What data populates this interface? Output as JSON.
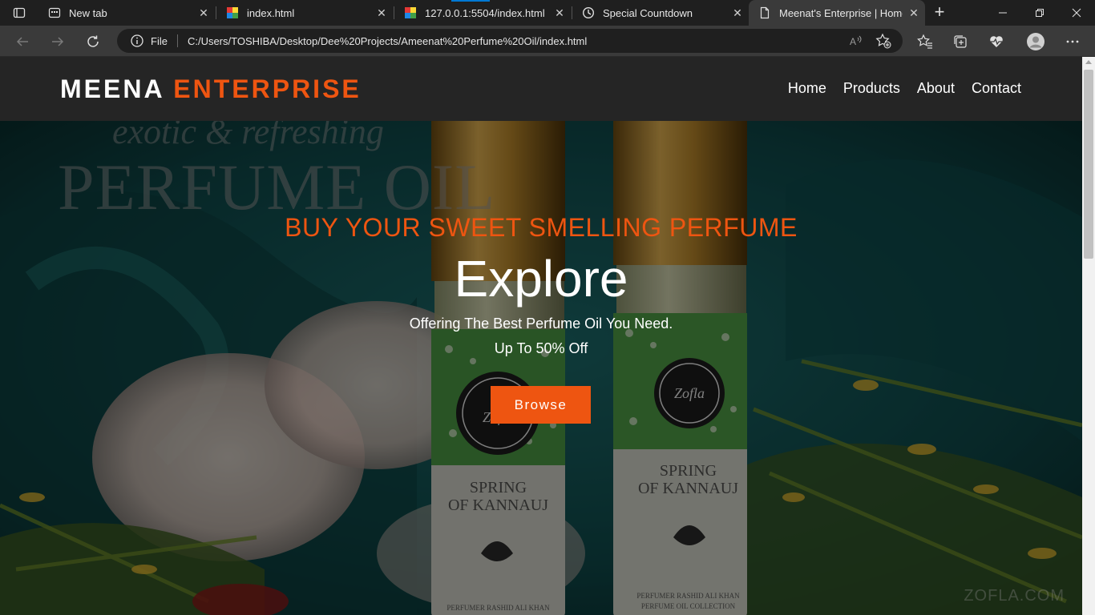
{
  "browser": {
    "tabs": [
      {
        "title": "New tab",
        "active": false
      },
      {
        "title": "index.html",
        "active": false
      },
      {
        "title": "127.0.0.1:5504/index.html",
        "active": false
      },
      {
        "title": "Special Countdown",
        "active": false
      },
      {
        "title": "Meenat's Enterprise | Home",
        "active": true
      }
    ],
    "address": {
      "scheme_label": "File",
      "url": "C:/Users/TOSHIBA/Desktop/Dee%20Projects/Ameenat%20Perfume%20Oil/index.html"
    },
    "icons": [
      "back-icon",
      "forward-icon",
      "refresh-icon",
      "info-icon",
      "read-aloud-icon",
      "add-favorite-icon",
      "favorites-icon",
      "collections-icon",
      "browser-essentials-icon",
      "profile-icon",
      "more-icon"
    ],
    "accent": "#0078d4"
  },
  "site": {
    "logo_primary": "MEENA",
    "logo_accent": "ENTERPRISE",
    "nav": [
      "Home",
      "Products",
      "About",
      "Contact"
    ],
    "hero": {
      "tagline": "BUY YOUR SWEET SMELLING PERFUME",
      "title": "Explore",
      "subtitle": "Offering The Best Perfume Oil You Need.",
      "offer": "Up To 50% Off",
      "button_label": "Browse"
    },
    "background_image": {
      "script_text": "exotic & refreshing",
      "headline": "PERFUME OIL",
      "bottle_brand": "Zofla",
      "bottle_label": [
        "SPRING",
        "OF KANNAUJ"
      ],
      "bottle_small_text": [
        "PERFUMER RASHID ALI KHAN",
        "PERFUME OIL COLLECTION"
      ],
      "watermark": "ZOFLA.COM"
    },
    "colors": {
      "accent": "#ee5511",
      "header_bg": "#252525",
      "text": "#ffffff"
    }
  }
}
